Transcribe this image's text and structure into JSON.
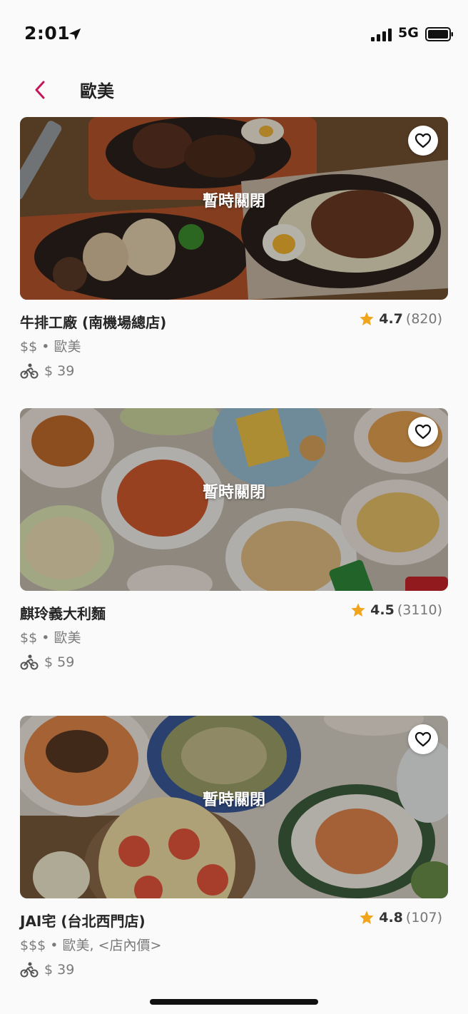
{
  "status_bar": {
    "time": "2:01",
    "network": "5G"
  },
  "nav": {
    "title": "歐美"
  },
  "colors": {
    "accent": "#c2185b",
    "star": "#f0a51c",
    "closed_overlay": "#000000"
  },
  "icons": {
    "back": "chevron-left-icon",
    "favorite": "heart-outline-icon",
    "rating": "star-icon",
    "delivery": "bike-icon"
  },
  "restaurants": [
    {
      "status": "暫時關閉",
      "name": "牛排工廠 (南機場總店)",
      "rating": "4.7",
      "reviews": "(820)",
      "price_cuisine": "$$ • 歐美",
      "delivery_fee": "$ 39"
    },
    {
      "status": "暫時關閉",
      "name": "麒玲義大利麵",
      "rating": "4.5",
      "reviews": "(3110)",
      "price_cuisine": "$$ • 歐美",
      "delivery_fee": "$ 59"
    },
    {
      "status": "暫時關閉",
      "name": "JAI宅 (台北西門店)",
      "rating": "4.8",
      "reviews": "(107)",
      "price_cuisine": "$$$ • 歐美, <店內價>",
      "delivery_fee": "$ 39"
    }
  ]
}
